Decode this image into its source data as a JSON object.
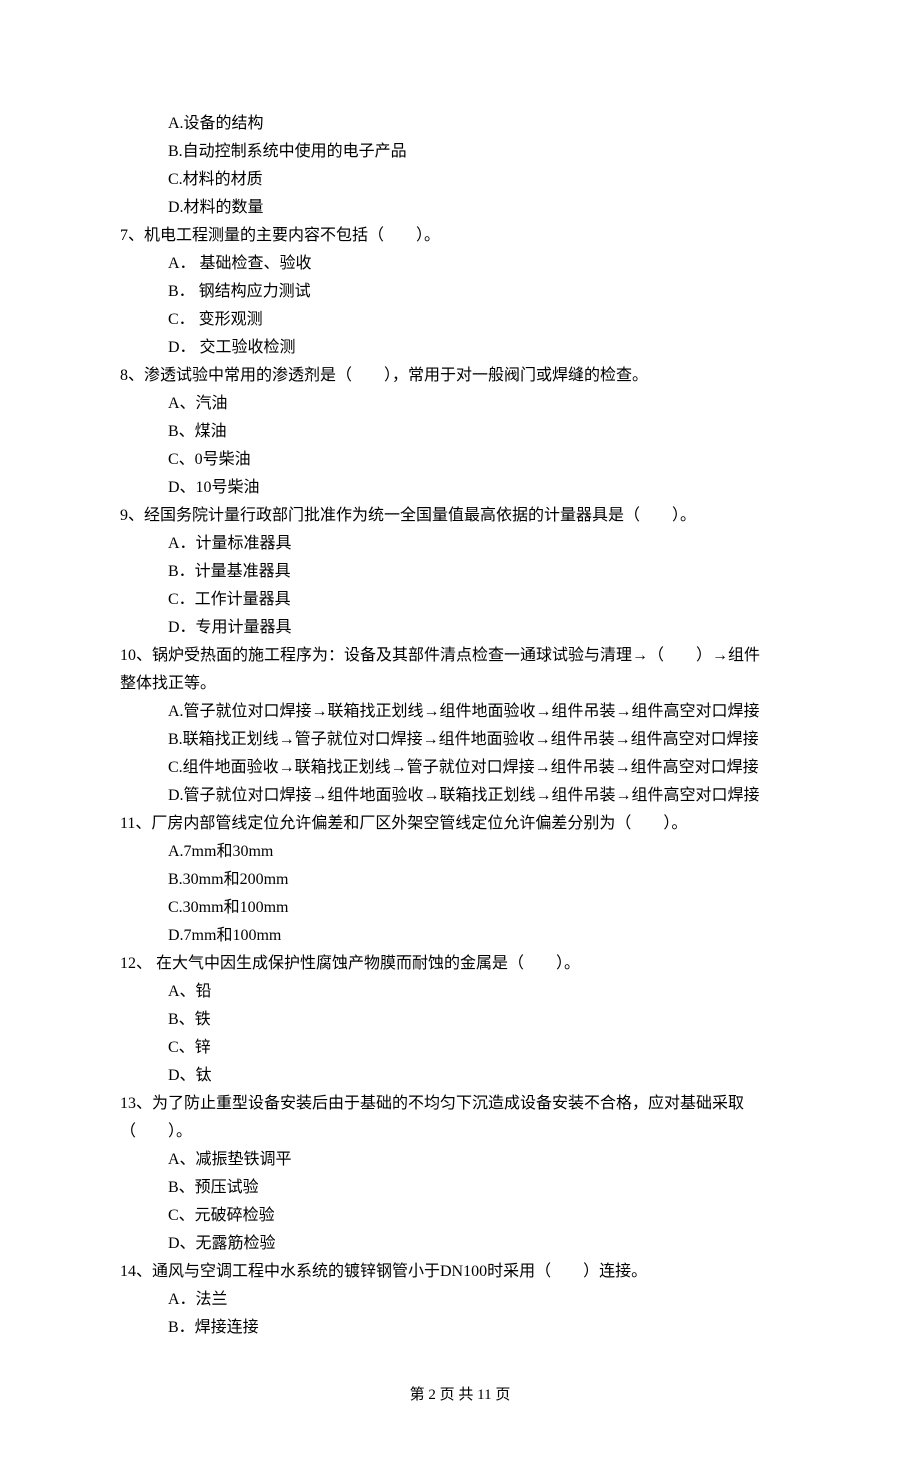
{
  "q6_options": {
    "A": "A.设备的结构",
    "B": "B.自动控制系统中使用的电子产品",
    "C": "C.材料的材质",
    "D": "D.材料的数量"
  },
  "q7": {
    "stem": "7、机电工程测量的主要内容不包括（　　）。",
    "A": "A． 基础检查、验收",
    "B": "B． 钢结构应力测试",
    "C": "C． 变形观测",
    "D": "D． 交工验收检测"
  },
  "q8": {
    "stem": "8、渗透试验中常用的渗透剂是（　　），常用于对一般阀门或焊缝的检查。",
    "A": "A、汽油",
    "B": "B、煤油",
    "C": "C、0号柴油",
    "D": "D、10号柴油"
  },
  "q9": {
    "stem": "9、经国务院计量行政部门批准作为统一全国量值最高依据的计量器具是（　　）。",
    "A": "A．计量标准器具",
    "B": "B．计量基准器具",
    "C": "C．工作计量器具",
    "D": "D．专用计量器具"
  },
  "q10": {
    "stem_l1": "10、锅炉受热面的施工程序为：设备及其部件清点检查一通球试验与清理→（　　）→组件",
    "stem_l2": "整体找正等。",
    "A": "A.管子就位对口焊接→联箱找正划线→组件地面验收→组件吊装→组件高空对口焊接",
    "B": "B.联箱找正划线→管子就位对口焊接→组件地面验收→组件吊装→组件高空对口焊接",
    "C": "C.组件地面验收→联箱找正划线→管子就位对口焊接→组件吊装→组件高空对口焊接",
    "D": "D.管子就位对口焊接→组件地面验收→联箱找正划线→组件吊装→组件高空对口焊接"
  },
  "q11": {
    "stem": "11、厂房内部管线定位允许偏差和厂区外架空管线定位允许偏差分别为（　　）。",
    "A": "A.7mm和30mm",
    "B": "B.30mm和200mm",
    "C": "C.30mm和100mm",
    "D": "D.7mm和100mm"
  },
  "q12": {
    "stem": "12、 在大气中因生成保护性腐蚀产物膜而耐蚀的金属是（　　）。",
    "A": "A、铅",
    "B": "B、铁",
    "C": "C、锌",
    "D": "D、钛"
  },
  "q13": {
    "stem_l1": "13、为了防止重型设备安装后由于基础的不均匀下沉造成设备安装不合格，应对基础采取",
    "stem_l2": "（　　）。",
    "A": "A、减振垫铁调平",
    "B": "B、预压试验",
    "C": "C、元破碎检验",
    "D": "D、无露筋检验"
  },
  "q14": {
    "stem": "14、通风与空调工程中水系统的镀锌钢管小于DN100时采用（　　）连接。",
    "A": "A．法兰",
    "B": "B．焊接连接"
  },
  "footer": "第 2 页 共 11 页"
}
